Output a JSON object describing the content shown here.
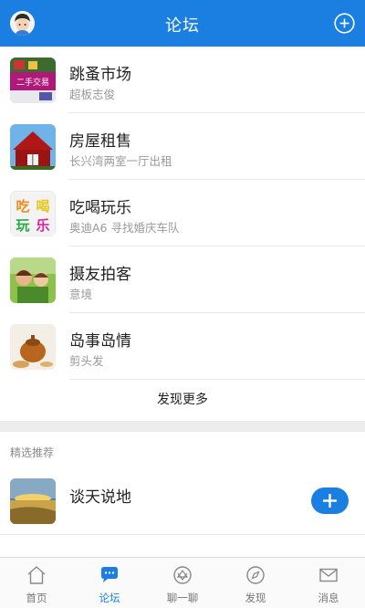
{
  "header": {
    "title": "论坛",
    "avatar_icon": "user-avatar",
    "add_icon": "plus-circle-icon"
  },
  "forums": [
    {
      "name": "跳蚤市场",
      "latest": "超板志俊",
      "thumb_text": "二手交易"
    },
    {
      "name": "房屋租售",
      "latest": "长兴湾两室一厅出租"
    },
    {
      "name": "吃喝玩乐",
      "latest": "奥迪A6 寻找婚庆车队",
      "thumb_text": [
        "吃",
        "喝",
        "玩",
        "乐"
      ]
    },
    {
      "name": "摄友拍客",
      "latest": "意境"
    },
    {
      "name": "岛事岛情",
      "latest": "剪头发"
    }
  ],
  "more_label": "发现更多",
  "recommend": {
    "section_title": "精选推荐",
    "items": [
      {
        "name": "谈天说地",
        "action_icon": "plus-icon"
      }
    ]
  },
  "tabbar": {
    "tabs": [
      {
        "label": "首页",
        "icon": "home-icon",
        "active": false
      },
      {
        "label": "论坛",
        "icon": "chat-bubble-icon",
        "active": true
      },
      {
        "label": "聊一聊",
        "icon": "chat-circle-icon",
        "active": false
      },
      {
        "label": "发现",
        "icon": "compass-icon",
        "active": false
      },
      {
        "label": "消息",
        "icon": "mail-icon",
        "active": false
      }
    ]
  },
  "colors": {
    "brand": "#1a7fe0",
    "text": "#222222",
    "muted": "#999999"
  }
}
